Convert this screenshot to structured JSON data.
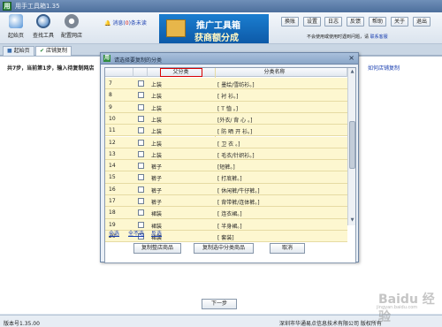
{
  "app": {
    "title": "用手工具箱1.35"
  },
  "toolbar": {
    "start_label": "起始页",
    "find_label": "查找工具",
    "config_label": "配置网店",
    "msg_prefix": "消息(",
    "msg_count": "0",
    "msg_suffix": ")条未读",
    "banner_line1": "推广工具箱",
    "banner_line2": "获商额分成",
    "btn_switch": "换账",
    "btn_settings": "设置",
    "btn_log": "日志",
    "btn_feedback": "反馈",
    "btn_help": "帮助",
    "btn_about": "关于",
    "btn_exit": "退出",
    "note_text": "不会使用或使用时遇到问题，请",
    "note_link": "联系客服"
  },
  "tabs": [
    {
      "label": "起始页"
    },
    {
      "label": "店铺复制"
    }
  ],
  "content": {
    "step_text": "共7步，当前第1步，输入待复制网店",
    "help_link": "如何店铺复制",
    "next_button": "下一步"
  },
  "dialog": {
    "title": "请选择要复制的分类",
    "close": "×",
    "col_parent": "父分类",
    "col_name": "分类名称",
    "rows": [
      {
        "n": "7",
        "parent": "上装",
        "name": "[ 墨绘/雪纺衫。]"
      },
      {
        "n": "8",
        "parent": "上装",
        "name": "[ 衬 衫。]"
      },
      {
        "n": "9",
        "parent": "上装",
        "name": "[ T 恤 。]"
      },
      {
        "n": "10",
        "parent": "上装",
        "name": "[外衣/ 背 心 。]"
      },
      {
        "n": "11",
        "parent": "上装",
        "name": "[ 防 晒 开 衫。]"
      },
      {
        "n": "12",
        "parent": "上装",
        "name": "[ 卫 衣 。]"
      },
      {
        "n": "13",
        "parent": "上装",
        "name": "[ 毛衣/针织衫。]"
      },
      {
        "n": "14",
        "parent": "裤子",
        "name": "[短裤。]"
      },
      {
        "n": "15",
        "parent": "裤子",
        "name": "[ 打底裤。]"
      },
      {
        "n": "16",
        "parent": "裤子",
        "name": "[ 休闲裤/牛仔裤。]"
      },
      {
        "n": "17",
        "parent": "裤子",
        "name": "[ 背带裤/连体裤。]"
      },
      {
        "n": "18",
        "parent": "裙装",
        "name": "[ 连衣裙。]"
      },
      {
        "n": "19",
        "parent": "裙装",
        "name": "[ 半身裙。]"
      },
      {
        "n": "20",
        "parent": "裙装",
        "name": "[ 套装]"
      }
    ],
    "select_all": "全选",
    "select_none": "全不选",
    "invert": "反选",
    "btn_copy_all": "复制整店商品",
    "btn_copy_selected": "复制选中分类商品",
    "btn_cancel": "取消"
  },
  "status": {
    "version": "版本号1.35.00",
    "company": "深圳市华通易点信息技术有限公司 版权所有"
  },
  "watermark": {
    "text": "Baidu 经验",
    "sub": "jingyan.baidu.com"
  }
}
